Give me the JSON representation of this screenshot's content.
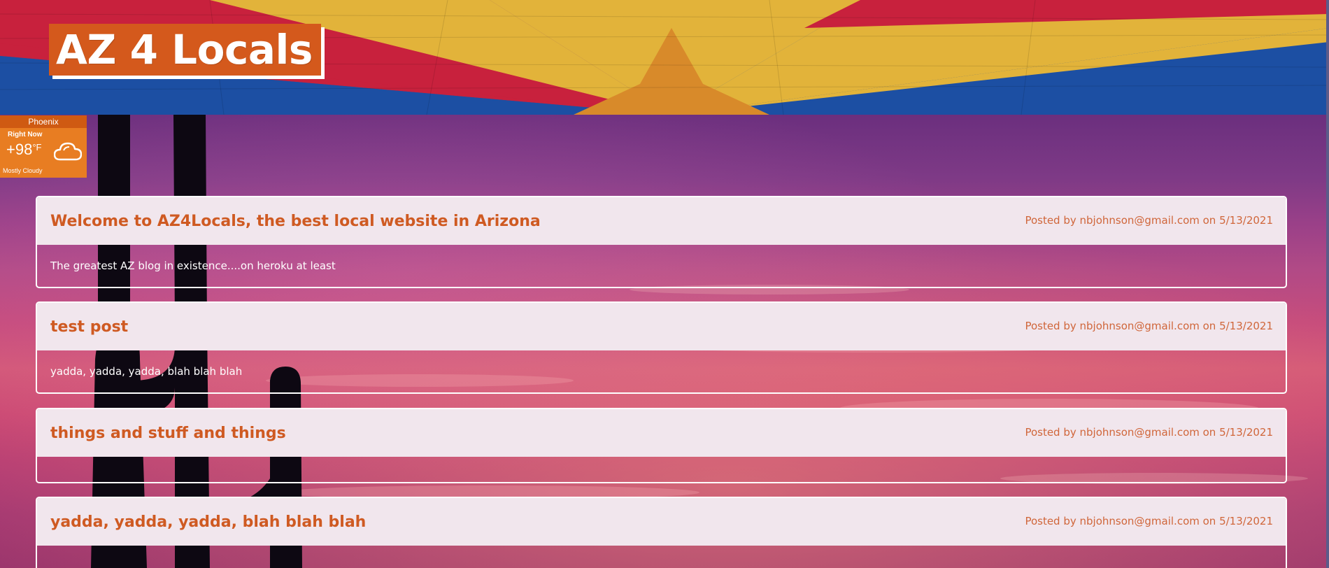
{
  "site": {
    "title": "AZ 4 Locals"
  },
  "weather": {
    "city": "Phoenix",
    "label": "Right Now",
    "temperature": "+98",
    "unit": "°F",
    "condition": "Mostly Cloudy",
    "icon": "cloud-icon"
  },
  "posts": [
    {
      "title": "Welcome to AZ4Locals, the best local website in Arizona",
      "meta": "Posted by nbjohnson@gmail.com on 5/13/2021",
      "body": "The greatest AZ blog in existence....on heroku at least"
    },
    {
      "title": "test post",
      "meta": "Posted by nbjohnson@gmail.com on 5/13/2021",
      "body": "yadda, yadda, yadda, blah blah blah"
    },
    {
      "title": "things and stuff and things",
      "meta": "Posted by nbjohnson@gmail.com on 5/13/2021",
      "body": ""
    },
    {
      "title": "yadda, yadda, yadda, blah blah blah",
      "meta": "Posted by nbjohnson@gmail.com on 5/13/2021",
      "body": ""
    }
  ],
  "colors": {
    "accent": "#d4591c",
    "card_header": "#f1e6ed",
    "post_title": "#cf5a22",
    "weather_bg": "#e87d22",
    "flag_blue": "#1c4fa3",
    "flag_red": "#c8213d",
    "flag_gold": "#e2b33a",
    "flag_copper": "#d88a2a"
  }
}
